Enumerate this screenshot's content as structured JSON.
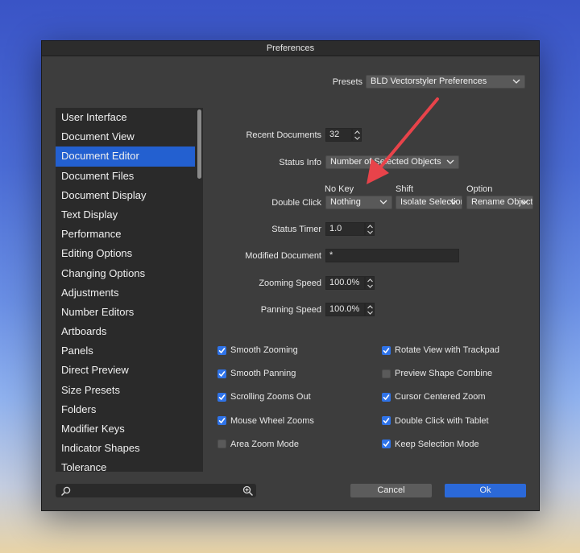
{
  "window": {
    "title": "Preferences"
  },
  "presets": {
    "label": "Presets",
    "value": "BLD Vectorstyler Preferences"
  },
  "sidebar": {
    "items": [
      {
        "label": "User Interface"
      },
      {
        "label": "Document View"
      },
      {
        "label": "Document Editor",
        "selected": true
      },
      {
        "label": "Document Files"
      },
      {
        "label": "Document Display"
      },
      {
        "label": "Text Display"
      },
      {
        "label": "Performance"
      },
      {
        "label": "Editing Options"
      },
      {
        "label": "Changing Options"
      },
      {
        "label": "Adjustments"
      },
      {
        "label": "Number Editors"
      },
      {
        "label": "Artboards"
      },
      {
        "label": "Panels"
      },
      {
        "label": "Direct Preview"
      },
      {
        "label": "Size Presets"
      },
      {
        "label": "Folders"
      },
      {
        "label": "Modifier Keys"
      },
      {
        "label": "Indicator Shapes"
      },
      {
        "label": "Tolerance"
      }
    ]
  },
  "settings": {
    "recent_documents": {
      "label": "Recent Documents",
      "value": "32"
    },
    "status_info": {
      "label": "Status Info",
      "value": "Number of Selected Objects"
    },
    "double_click": {
      "label": "Double Click",
      "no_key": {
        "header": "No Key",
        "value": "Nothing"
      },
      "shift": {
        "header": "Shift",
        "value": "Isolate Selection"
      },
      "option": {
        "header": "Option",
        "value": "Rename Object"
      }
    },
    "status_timer": {
      "label": "Status Timer",
      "value": "1.0"
    },
    "modified_document": {
      "label": "Modified Document",
      "value": "*"
    },
    "zooming_speed": {
      "label": "Zooming Speed",
      "value": "100.0%"
    },
    "panning_speed": {
      "label": "Panning Speed",
      "value": "100.0%"
    }
  },
  "checkboxes": {
    "left": [
      {
        "label": "Smooth Zooming",
        "checked": true
      },
      {
        "label": "Smooth Panning",
        "checked": true
      },
      {
        "label": "Scrolling Zooms Out",
        "checked": true
      },
      {
        "label": "Mouse Wheel Zooms",
        "checked": true
      },
      {
        "label": "Area Zoom Mode",
        "checked": false
      }
    ],
    "right": [
      {
        "label": "Rotate View with Trackpad",
        "checked": true
      },
      {
        "label": "Preview Shape Combine",
        "checked": false
      },
      {
        "label": "Cursor Centered Zoom",
        "checked": true
      },
      {
        "label": "Double Click with Tablet",
        "checked": true
      },
      {
        "label": "Keep Selection Mode",
        "checked": true
      }
    ]
  },
  "footer": {
    "cancel_label": "Cancel",
    "ok_label": "Ok",
    "search_value": ""
  },
  "colors": {
    "accent": "#2360d0",
    "ok_button": "#2b69d9",
    "checkbox": "#2f73e8",
    "arrow": "#e8434a"
  }
}
